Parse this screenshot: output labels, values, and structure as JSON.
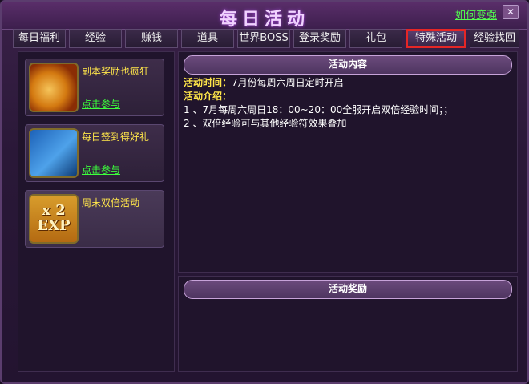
{
  "window": {
    "title": "每日活动",
    "help_link": "如何变强",
    "close_symbol": "✕"
  },
  "tabs": [
    {
      "label": "每日福利"
    },
    {
      "label": "经验"
    },
    {
      "label": "赚钱"
    },
    {
      "label": "道具"
    },
    {
      "label": "世界BOSS"
    },
    {
      "label": "登录奖励"
    },
    {
      "label": "礼包"
    },
    {
      "label": "特殊活动",
      "active": true
    },
    {
      "label": "经验找回"
    }
  ],
  "activities": [
    {
      "title": "副本奖励也疯狂",
      "link": "点击参与",
      "icon": "money-bag-icon"
    },
    {
      "title": "每日签到得好礼",
      "link": "点击参与",
      "icon": "book-quill-icon"
    },
    {
      "title": "周末双倍活动",
      "icon": "double-exp-icon",
      "icon_text_top": "x 2",
      "icon_text_bottom": "EXP",
      "selected": true
    }
  ],
  "content": {
    "section_title": "活动内容",
    "time_label": "活动时间：",
    "time_value": "7月份每周六周日定时开启",
    "intro_label": "活动介绍：",
    "lines": [
      "1 、7月每周六周日18：00~20：00全服开启双倍经验时间；；",
      "2 、双倍经验可与其他经验符效果叠加"
    ]
  },
  "rewards": {
    "section_title": "活动奖励"
  },
  "colors": {
    "accent_yellow": "#ffe64a",
    "link_green": "#3cff3c",
    "active_tab_border": "#e52626"
  }
}
